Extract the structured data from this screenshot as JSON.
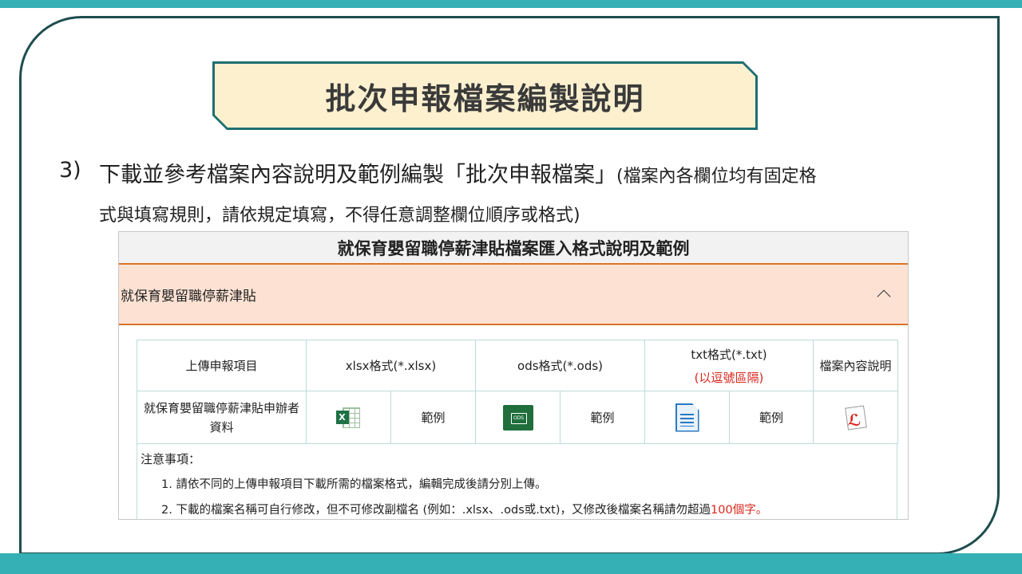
{
  "slide": {
    "title": "批次申報檔案編製說明",
    "step_number": "3)",
    "step_text_main": "下載並參考檔案內容說明及範例編製「批次申報檔案」",
    "step_text_note_a": "(檔案內各欄位均有固定格",
    "step_text_note_b": "式與填寫規則，請依規定填寫，不得任意調整欄位順序或格式)"
  },
  "panel": {
    "header": "就保育嬰留職停薪津貼檔案匯入格式說明及範例",
    "accordion_label": "就保育嬰留職停薪津貼",
    "table": {
      "col_item": "上傳申報項目",
      "col_xlsx": "xlsx格式(*.xlsx)",
      "col_ods": "ods格式(*.ods)",
      "col_txt": "txt格式(*.txt)",
      "col_txt_note": "(以逗號區隔)",
      "col_desc": "檔案內容說明",
      "row_item": "就保育嬰留職停薪津貼申辦者資料",
      "example_label": "範例",
      "xlsx_badge": "X",
      "ods_badge": "ODS"
    },
    "notes": {
      "title": "注意事項：",
      "item1": "1. 請依不同的上傳申報項目下載所需的檔案格式，編輯完成後請分別上傳。",
      "item2_prefix": "2. 下載的檔案名稱可自行修改，但不可修改副檔名 (例如：.xlsx、.ods或.txt)，又修改後檔案名稱請勿超過",
      "item2_highlight": "100個字",
      "item2_suffix": "。"
    }
  },
  "icons": {
    "xlsx": "excel-file-icon",
    "ods": "ods-file-icon",
    "txt": "text-file-icon",
    "pdf": "pdf-file-icon",
    "chevron": "chevron-up-icon"
  },
  "colors": {
    "teal_band": "#35b0b5",
    "frame": "#1e4d4f",
    "title_fill": "#fcf0cf",
    "accent_orange": "#d9732a",
    "accordion_fill": "#fde2d3",
    "warning_red": "#d9251c"
  }
}
